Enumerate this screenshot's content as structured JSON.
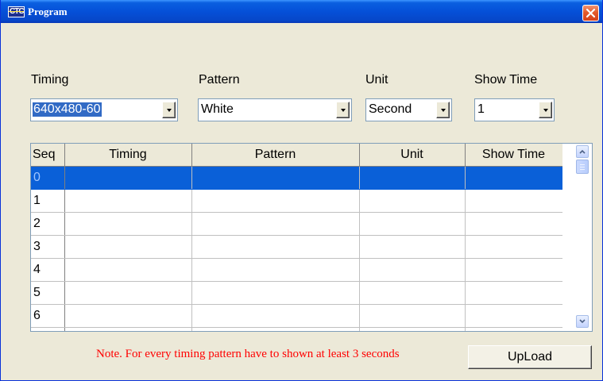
{
  "window": {
    "title": "Program",
    "icon_text": "CTC"
  },
  "controls": {
    "timing_label": "Timing",
    "pattern_label": "Pattern",
    "unit_label": "Unit",
    "showtime_label": "Show Time",
    "timing_value": "640x480-60",
    "pattern_value": "White",
    "unit_value": "Second",
    "showtime_value": "1"
  },
  "table": {
    "columns": [
      "Seq",
      "Timing",
      "Pattern",
      "Unit",
      "Show Time"
    ],
    "rows": [
      {
        "seq": "0",
        "timing": "",
        "pattern": "",
        "unit": "",
        "show_time": ""
      },
      {
        "seq": "1",
        "timing": "",
        "pattern": "",
        "unit": "",
        "show_time": ""
      },
      {
        "seq": "2",
        "timing": "",
        "pattern": "",
        "unit": "",
        "show_time": ""
      },
      {
        "seq": "3",
        "timing": "",
        "pattern": "",
        "unit": "",
        "show_time": ""
      },
      {
        "seq": "4",
        "timing": "",
        "pattern": "",
        "unit": "",
        "show_time": ""
      },
      {
        "seq": "5",
        "timing": "",
        "pattern": "",
        "unit": "",
        "show_time": ""
      },
      {
        "seq": "6",
        "timing": "",
        "pattern": "",
        "unit": "",
        "show_time": ""
      }
    ],
    "selected_row": 0
  },
  "footer": {
    "note": "Note.  For every timing pattern have to shown at least 3 seconds",
    "upload_label": "UpLoad"
  },
  "colors": {
    "selection": "#0a60d8",
    "note": "#ff0000",
    "titlebar": "#0550d8"
  }
}
